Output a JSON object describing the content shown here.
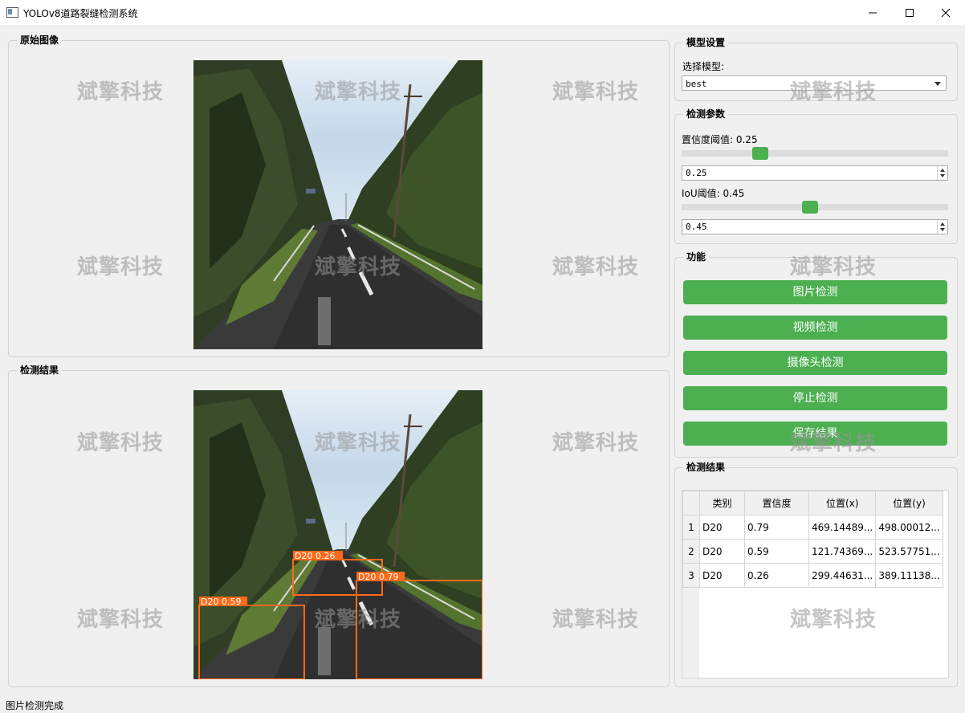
{
  "window": {
    "title": "YOLOv8道路裂缝检测系统",
    "icon": "app-window-icon"
  },
  "panels": {
    "original": {
      "title": "原始图像"
    },
    "result": {
      "title": "检测结果"
    }
  },
  "watermark": "斌擎科技",
  "model_settings": {
    "title": "模型设置",
    "select_label": "选择模型:",
    "selected_model": "best"
  },
  "detection_params": {
    "title": "检测参数",
    "confidence_label": "置信度阈值: 0.25",
    "confidence_value": "0.25",
    "confidence_level": 0.25,
    "iou_label": "IoU阈值: 0.45",
    "iou_value": "0.45",
    "iou_level": 0.45
  },
  "functions": {
    "title": "功能",
    "buttons": [
      "图片检测",
      "视频检测",
      "摄像头检测",
      "停止检测",
      "保存结果"
    ],
    "button_color": "#4caf50"
  },
  "results_table": {
    "title": "检测结果",
    "headers": [
      "类别",
      "置信度",
      "位置(x)",
      "位置(y)"
    ],
    "rows": [
      {
        "num": "1",
        "cls": "D20",
        "conf": "0.79",
        "x": "469.14489...",
        "y": "498.00012..."
      },
      {
        "num": "2",
        "cls": "D20",
        "conf": "0.59",
        "x": "121.74369...",
        "y": "523.57751..."
      },
      {
        "num": "3",
        "cls": "D20",
        "conf": "0.26",
        "x": "299.44631...",
        "y": "389.11138..."
      }
    ]
  },
  "detections": [
    {
      "label": "D20  0.26"
    },
    {
      "label": "D20  0.79"
    },
    {
      "label": "D20  0.59"
    }
  ],
  "detection_box_color": "#ff6a1a",
  "status": "图片检测完成"
}
